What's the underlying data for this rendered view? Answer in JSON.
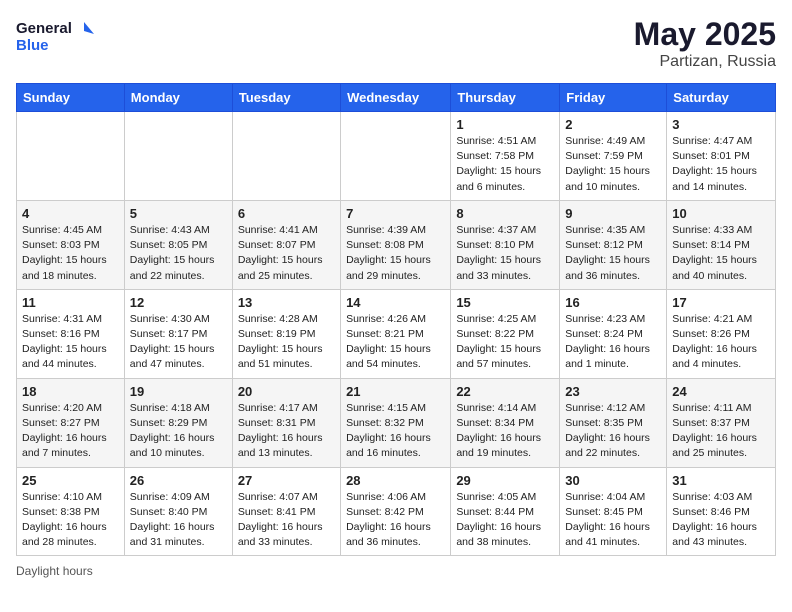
{
  "header": {
    "logo_line1": "General",
    "logo_line2": "Blue",
    "month": "May 2025",
    "location": "Partizan, Russia"
  },
  "days_of_week": [
    "Sunday",
    "Monday",
    "Tuesday",
    "Wednesday",
    "Thursday",
    "Friday",
    "Saturday"
  ],
  "weeks": [
    [
      {
        "num": "",
        "info": ""
      },
      {
        "num": "",
        "info": ""
      },
      {
        "num": "",
        "info": ""
      },
      {
        "num": "",
        "info": ""
      },
      {
        "num": "1",
        "info": "Sunrise: 4:51 AM\nSunset: 7:58 PM\nDaylight: 15 hours and 6 minutes."
      },
      {
        "num": "2",
        "info": "Sunrise: 4:49 AM\nSunset: 7:59 PM\nDaylight: 15 hours and 10 minutes."
      },
      {
        "num": "3",
        "info": "Sunrise: 4:47 AM\nSunset: 8:01 PM\nDaylight: 15 hours and 14 minutes."
      }
    ],
    [
      {
        "num": "4",
        "info": "Sunrise: 4:45 AM\nSunset: 8:03 PM\nDaylight: 15 hours and 18 minutes."
      },
      {
        "num": "5",
        "info": "Sunrise: 4:43 AM\nSunset: 8:05 PM\nDaylight: 15 hours and 22 minutes."
      },
      {
        "num": "6",
        "info": "Sunrise: 4:41 AM\nSunset: 8:07 PM\nDaylight: 15 hours and 25 minutes."
      },
      {
        "num": "7",
        "info": "Sunrise: 4:39 AM\nSunset: 8:08 PM\nDaylight: 15 hours and 29 minutes."
      },
      {
        "num": "8",
        "info": "Sunrise: 4:37 AM\nSunset: 8:10 PM\nDaylight: 15 hours and 33 minutes."
      },
      {
        "num": "9",
        "info": "Sunrise: 4:35 AM\nSunset: 8:12 PM\nDaylight: 15 hours and 36 minutes."
      },
      {
        "num": "10",
        "info": "Sunrise: 4:33 AM\nSunset: 8:14 PM\nDaylight: 15 hours and 40 minutes."
      }
    ],
    [
      {
        "num": "11",
        "info": "Sunrise: 4:31 AM\nSunset: 8:16 PM\nDaylight: 15 hours and 44 minutes."
      },
      {
        "num": "12",
        "info": "Sunrise: 4:30 AM\nSunset: 8:17 PM\nDaylight: 15 hours and 47 minutes."
      },
      {
        "num": "13",
        "info": "Sunrise: 4:28 AM\nSunset: 8:19 PM\nDaylight: 15 hours and 51 minutes."
      },
      {
        "num": "14",
        "info": "Sunrise: 4:26 AM\nSunset: 8:21 PM\nDaylight: 15 hours and 54 minutes."
      },
      {
        "num": "15",
        "info": "Sunrise: 4:25 AM\nSunset: 8:22 PM\nDaylight: 15 hours and 57 minutes."
      },
      {
        "num": "16",
        "info": "Sunrise: 4:23 AM\nSunset: 8:24 PM\nDaylight: 16 hours and 1 minute."
      },
      {
        "num": "17",
        "info": "Sunrise: 4:21 AM\nSunset: 8:26 PM\nDaylight: 16 hours and 4 minutes."
      }
    ],
    [
      {
        "num": "18",
        "info": "Sunrise: 4:20 AM\nSunset: 8:27 PM\nDaylight: 16 hours and 7 minutes."
      },
      {
        "num": "19",
        "info": "Sunrise: 4:18 AM\nSunset: 8:29 PM\nDaylight: 16 hours and 10 minutes."
      },
      {
        "num": "20",
        "info": "Sunrise: 4:17 AM\nSunset: 8:31 PM\nDaylight: 16 hours and 13 minutes."
      },
      {
        "num": "21",
        "info": "Sunrise: 4:15 AM\nSunset: 8:32 PM\nDaylight: 16 hours and 16 minutes."
      },
      {
        "num": "22",
        "info": "Sunrise: 4:14 AM\nSunset: 8:34 PM\nDaylight: 16 hours and 19 minutes."
      },
      {
        "num": "23",
        "info": "Sunrise: 4:12 AM\nSunset: 8:35 PM\nDaylight: 16 hours and 22 minutes."
      },
      {
        "num": "24",
        "info": "Sunrise: 4:11 AM\nSunset: 8:37 PM\nDaylight: 16 hours and 25 minutes."
      }
    ],
    [
      {
        "num": "25",
        "info": "Sunrise: 4:10 AM\nSunset: 8:38 PM\nDaylight: 16 hours and 28 minutes."
      },
      {
        "num": "26",
        "info": "Sunrise: 4:09 AM\nSunset: 8:40 PM\nDaylight: 16 hours and 31 minutes."
      },
      {
        "num": "27",
        "info": "Sunrise: 4:07 AM\nSunset: 8:41 PM\nDaylight: 16 hours and 33 minutes."
      },
      {
        "num": "28",
        "info": "Sunrise: 4:06 AM\nSunset: 8:42 PM\nDaylight: 16 hours and 36 minutes."
      },
      {
        "num": "29",
        "info": "Sunrise: 4:05 AM\nSunset: 8:44 PM\nDaylight: 16 hours and 38 minutes."
      },
      {
        "num": "30",
        "info": "Sunrise: 4:04 AM\nSunset: 8:45 PM\nDaylight: 16 hours and 41 minutes."
      },
      {
        "num": "31",
        "info": "Sunrise: 4:03 AM\nSunset: 8:46 PM\nDaylight: 16 hours and 43 minutes."
      }
    ]
  ],
  "footer": {
    "daylight_hours": "Daylight hours"
  }
}
